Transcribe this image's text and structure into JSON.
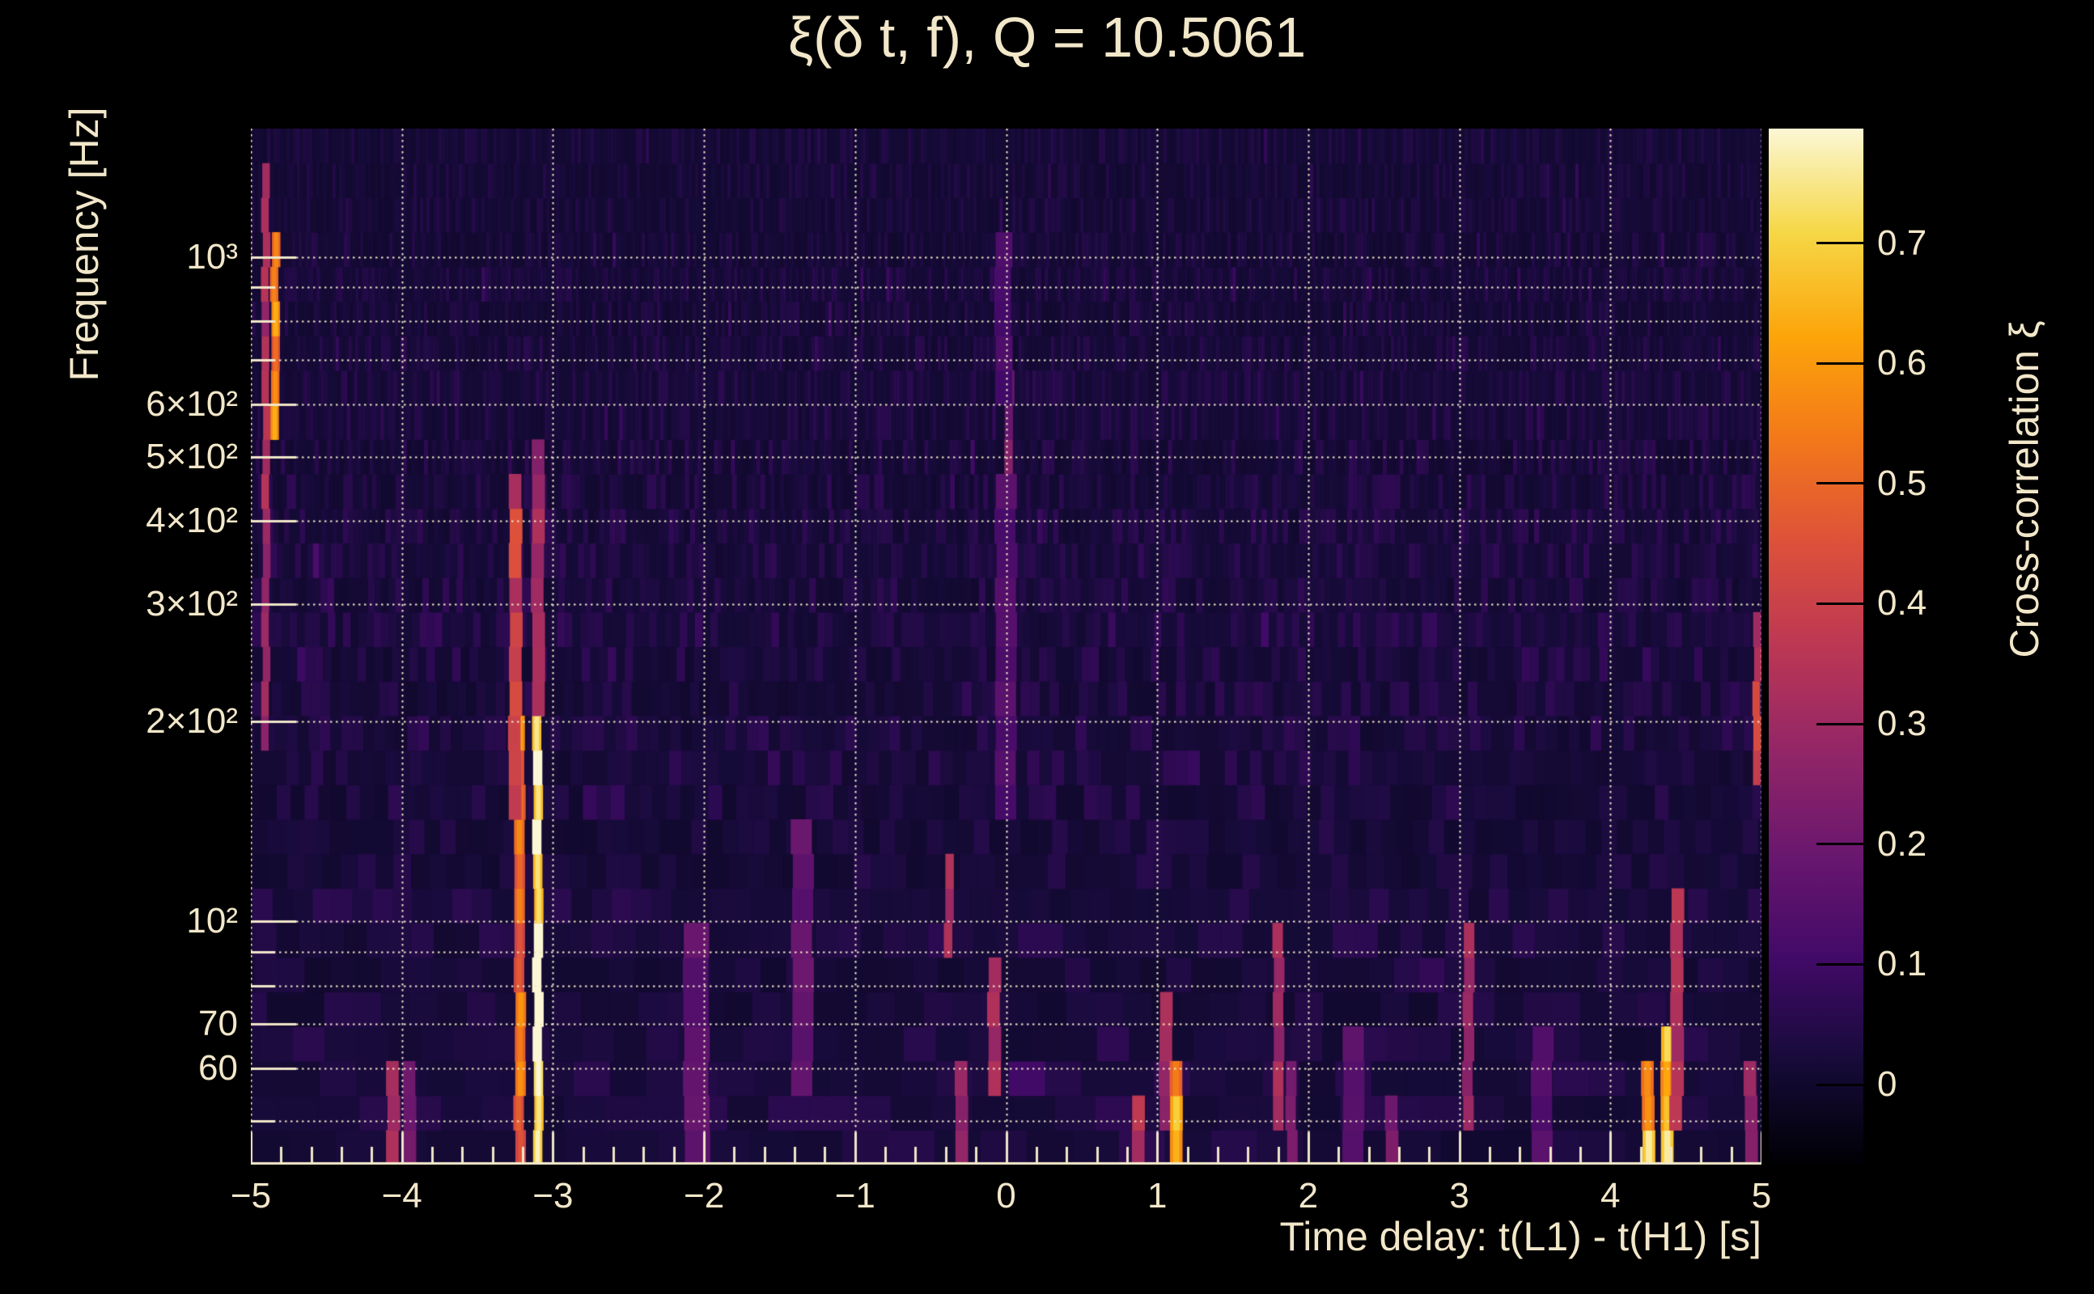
{
  "title": "ξ(δ t, f), Q = 10.5061",
  "axes": {
    "x": {
      "label": "Time delay: t(L1) - t(H1) [s]",
      "min": -5,
      "max": 5,
      "major_ticks": [
        -5,
        -4,
        -3,
        -2,
        -1,
        0,
        1,
        2,
        3,
        4,
        5
      ],
      "tick_labels": [
        "−5",
        "−4",
        "−3",
        "−2",
        "−1",
        "0",
        "1",
        "2",
        "3",
        "4",
        "5"
      ],
      "minor_tick_step": 0.2
    },
    "y": {
      "label": "Frequency [Hz]",
      "scale": "log",
      "min_hz": 43,
      "max_hz": 1560,
      "ticks": [
        {
          "hz": 1000,
          "label": "10³"
        },
        {
          "hz": 900
        },
        {
          "hz": 800
        },
        {
          "hz": 700
        },
        {
          "hz": 600,
          "label": "6×10²"
        },
        {
          "hz": 500,
          "label": "5×10²"
        },
        {
          "hz": 400,
          "label": "4×10²"
        },
        {
          "hz": 300,
          "label": "3×10²"
        },
        {
          "hz": 200,
          "label": "2×10²"
        },
        {
          "hz": 100,
          "label": "10²"
        },
        {
          "hz": 90
        },
        {
          "hz": 80
        },
        {
          "hz": 70,
          "label": "70"
        },
        {
          "hz": 60,
          "label": "60"
        },
        {
          "hz": 50
        }
      ]
    }
  },
  "colorbar": {
    "label": "Cross-correlation ξ",
    "tick_values": [
      0,
      0.1,
      0.2,
      0.3,
      0.4,
      0.5,
      0.6,
      0.7
    ],
    "tick_labels": [
      "0",
      "0.1",
      "0.2",
      "0.3",
      "0.4",
      "0.5",
      "0.6",
      "0.7"
    ],
    "value_min": -0.067,
    "value_max": 0.795,
    "colormap": "inferno",
    "colormap_stops": [
      {
        "pos": 0.0,
        "color": "#000004"
      },
      {
        "pos": 0.1,
        "color": "#160b39"
      },
      {
        "pos": 0.2,
        "color": "#420a68"
      },
      {
        "pos": 0.3,
        "color": "#6a176e"
      },
      {
        "pos": 0.4,
        "color": "#932667"
      },
      {
        "pos": 0.5,
        "color": "#bc3754"
      },
      {
        "pos": 0.6,
        "color": "#dd513a"
      },
      {
        "pos": 0.7,
        "color": "#f37819"
      },
      {
        "pos": 0.8,
        "color": "#fca50a"
      },
      {
        "pos": 0.9,
        "color": "#f6d746"
      },
      {
        "pos": 1.0,
        "color": "#fbf7d5"
      }
    ]
  },
  "colors": {
    "background": "#000000",
    "text": "#f2e7c9",
    "grid": "#f0e6c8"
  },
  "chart_data": {
    "type": "heatmap",
    "title": "ξ(δ t, f), Q = 10.5061",
    "xlabel": "Time delay: t(L1) - t(H1) [s]",
    "ylabel": "Frequency [Hz]",
    "x_range": [
      -5,
      5
    ],
    "y_range_hz": [
      43,
      1560
    ],
    "y_scale": "log",
    "color_label": "Cross-correlation ξ",
    "color_range": [
      -0.067,
      0.795
    ],
    "colormap": "inferno",
    "background_noise": {
      "xi_typical": 0.02,
      "xi_max": 0.12,
      "texture": "vertical Q-transform tile striations on dark purple background; tile width grows toward low frequency"
    },
    "features": [
      {
        "t": -4.9,
        "f_lo": 200,
        "f_hi": 1270,
        "xi": 0.32,
        "sigma_t": 0.018
      },
      {
        "t": -4.84,
        "f_lo": 550,
        "f_hi": 1070,
        "xi": 0.5,
        "sigma_t": 0.02
      },
      {
        "t": -3.1,
        "f_lo": 43,
        "f_hi": 215,
        "xi": 0.79,
        "sigma_t": 0.022
      },
      {
        "t": -3.1,
        "f_lo": 215,
        "f_hi": 520,
        "xi": 0.3,
        "sigma_t": 0.03
      },
      {
        "t": -3.22,
        "f_lo": 43,
        "f_hi": 200,
        "xi": 0.5,
        "sigma_t": 0.025
      },
      {
        "t": -3.25,
        "f_lo": 140,
        "f_hi": 430,
        "xi": 0.4,
        "sigma_t": 0.03
      },
      {
        "t": -4.06,
        "f_lo": 43,
        "f_hi": 56,
        "xi": 0.3,
        "sigma_t": 0.03
      },
      {
        "t": -3.95,
        "f_lo": 47,
        "f_hi": 62,
        "xi": 0.22,
        "sigma_t": 0.03
      },
      {
        "t": -2.05,
        "f_lo": 43,
        "f_hi": 95,
        "xi": 0.17,
        "sigma_t": 0.06
      },
      {
        "t": -1.35,
        "f_lo": 60,
        "f_hi": 130,
        "xi": 0.17,
        "sigma_t": 0.05
      },
      {
        "t": -0.38,
        "f_lo": 95,
        "f_hi": 118,
        "xi": 0.32,
        "sigma_t": 0.02
      },
      {
        "t": -0.3,
        "f_lo": 43,
        "f_hi": 60,
        "xi": 0.26,
        "sigma_t": 0.03
      },
      {
        "t": -0.08,
        "f_lo": 55,
        "f_hi": 80,
        "xi": 0.35,
        "sigma_t": 0.03
      },
      {
        "t": 0.02,
        "f_lo": 430,
        "f_hi": 660,
        "xi": 0.22,
        "sigma_t": 0.02
      },
      {
        "t": 0.0,
        "f_lo": 150,
        "f_hi": 430,
        "xi": 0.14,
        "sigma_t": 0.05
      },
      {
        "t": -0.02,
        "f_lo": 660,
        "f_hi": 1100,
        "xi": 0.12,
        "sigma_t": 0.04
      },
      {
        "t": 0.87,
        "f_lo": 43,
        "f_hi": 52,
        "xi": 0.35,
        "sigma_t": 0.03
      },
      {
        "t": 1.06,
        "f_lo": 48,
        "f_hi": 72,
        "xi": 0.3,
        "sigma_t": 0.03
      },
      {
        "t": 1.12,
        "f_lo": 43,
        "f_hi": 56,
        "xi": 0.55,
        "sigma_t": 0.03
      },
      {
        "t": 1.8,
        "f_lo": 50,
        "f_hi": 92,
        "xi": 0.3,
        "sigma_t": 0.025
      },
      {
        "t": 1.89,
        "f_lo": 43,
        "f_hi": 60,
        "xi": 0.25,
        "sigma_t": 0.025
      },
      {
        "t": 2.3,
        "f_lo": 43,
        "f_hi": 70,
        "xi": 0.15,
        "sigma_t": 0.05
      },
      {
        "t": 2.55,
        "f_lo": 43,
        "f_hi": 55,
        "xi": 0.22,
        "sigma_t": 0.03
      },
      {
        "t": 3.06,
        "f_lo": 53,
        "f_hi": 100,
        "xi": 0.3,
        "sigma_t": 0.025
      },
      {
        "t": 3.55,
        "f_lo": 43,
        "f_hi": 65,
        "xi": 0.15,
        "sigma_t": 0.05
      },
      {
        "t": 4.25,
        "f_lo": 43,
        "f_hi": 62,
        "xi": 0.62,
        "sigma_t": 0.03
      },
      {
        "t": 4.37,
        "f_lo": 43,
        "f_hi": 64,
        "xi": 0.6,
        "sigma_t": 0.03
      },
      {
        "t": 4.44,
        "f_lo": 50,
        "f_hi": 110,
        "xi": 0.32,
        "sigma_t": 0.03
      },
      {
        "t": 4.93,
        "f_lo": 43,
        "f_hi": 58,
        "xi": 0.28,
        "sigma_t": 0.03
      },
      {
        "t": 4.97,
        "f_lo": 165,
        "f_hi": 265,
        "xi": 0.38,
        "sigma_t": 0.018
      }
    ]
  }
}
